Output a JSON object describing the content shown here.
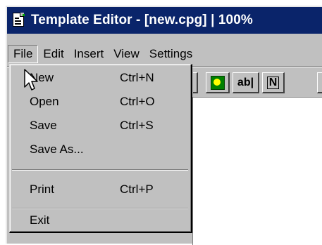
{
  "window": {
    "title": "Template Editor - [new.cpg] | 100%"
  },
  "menubar": {
    "items": [
      {
        "label": "File"
      },
      {
        "label": "Edit"
      },
      {
        "label": "Insert"
      },
      {
        "label": "View"
      },
      {
        "label": "Settings"
      }
    ]
  },
  "file_menu": {
    "new": {
      "label": "New",
      "shortcut": "Ctrl+N"
    },
    "open": {
      "label": "Open",
      "shortcut": "Ctrl+O"
    },
    "save": {
      "label": "Save",
      "shortcut": "Ctrl+S"
    },
    "save_as": {
      "label": "Save As..."
    },
    "print": {
      "label": "Print",
      "shortcut": "Ctrl+P"
    },
    "exit": {
      "label": "Exit"
    }
  },
  "toolbar": {
    "text_button_label": "ab|",
    "n_button_label": "N"
  }
}
